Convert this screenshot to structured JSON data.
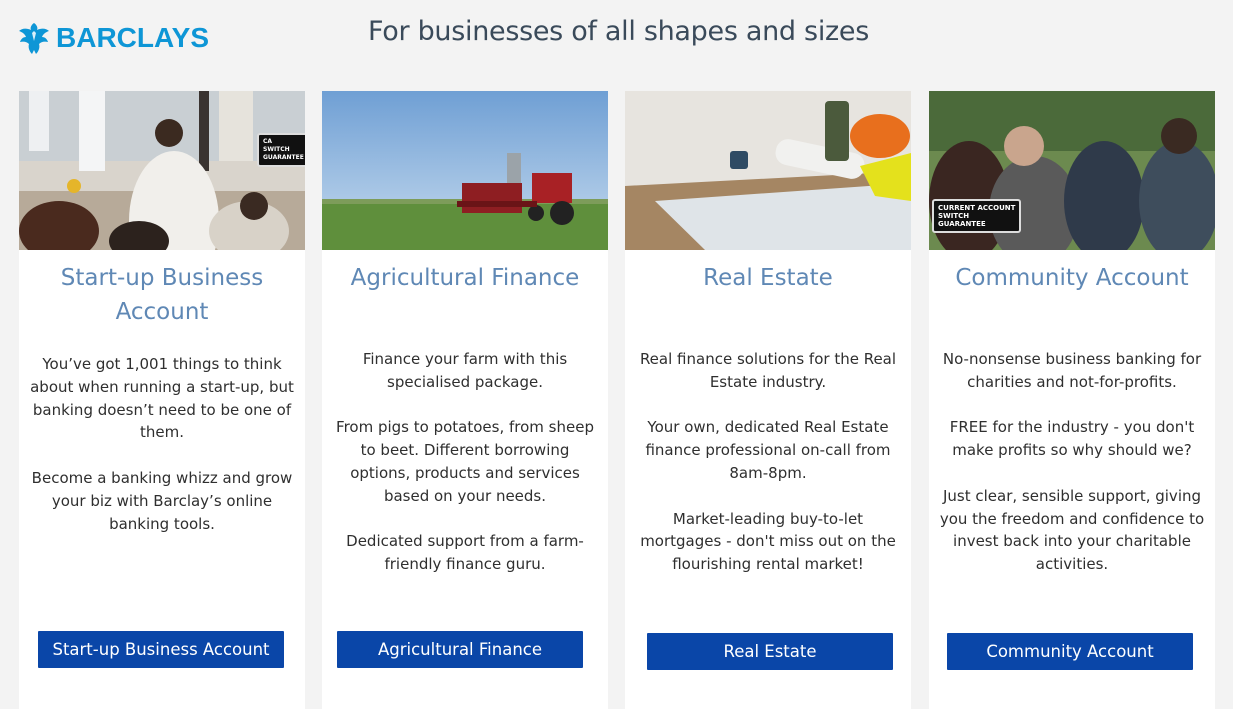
{
  "brand": {
    "name": "BARCLAYS",
    "logo_icon": "eagle-icon",
    "color": "#0e96d6"
  },
  "headline": "For businesses of all shapes and sizes",
  "colors": {
    "cta": "#0a46a8",
    "title": "#5f88b5",
    "background": "#f3f3f3"
  },
  "cards": [
    {
      "image": "startup-meeting-photo",
      "title_lines": [
        "Start-up Business",
        "Account"
      ],
      "paragraphs": [
        "You’ve got 1,001 things to think about when running a start-up, but banking doesn’t need to be one of them.",
        "Become a banking whizz and grow your biz with Barclay’s online banking tools."
      ],
      "button": "Start-up Business Account"
    },
    {
      "image": "tractor-field-photo",
      "title_lines": [
        "Agricultural Finance"
      ],
      "paragraphs": [
        "Finance your farm with this specialised package.",
        "From pigs to potatoes, from sheep to beet. Different borrowing options, products and services based on your needs.",
        "Dedicated support from a farm-friendly finance guru."
      ],
      "button": "Agricultural Finance"
    },
    {
      "image": "blueprints-desk-photo",
      "title_lines": [
        "Real Estate"
      ],
      "paragraphs": [
        "Real finance solutions for the Real Estate industry.",
        "Your own, dedicated Real Estate finance professional on-call from 8am-8pm.",
        "Market-leading buy-to-let mortgages - don't miss out on the flourishing rental market!"
      ],
      "button": "Real Estate"
    },
    {
      "image": "community-group-photo",
      "title_lines": [
        "Community Account"
      ],
      "paragraphs": [
        "No-nonsense business banking for charities and not-for-profits.",
        "FREE for the industry - you don't make profits so why should we?",
        "Just clear, sensible support, giving you the freedom and confidence to invest back into your charitable activities."
      ],
      "button": "Community Account"
    }
  ]
}
